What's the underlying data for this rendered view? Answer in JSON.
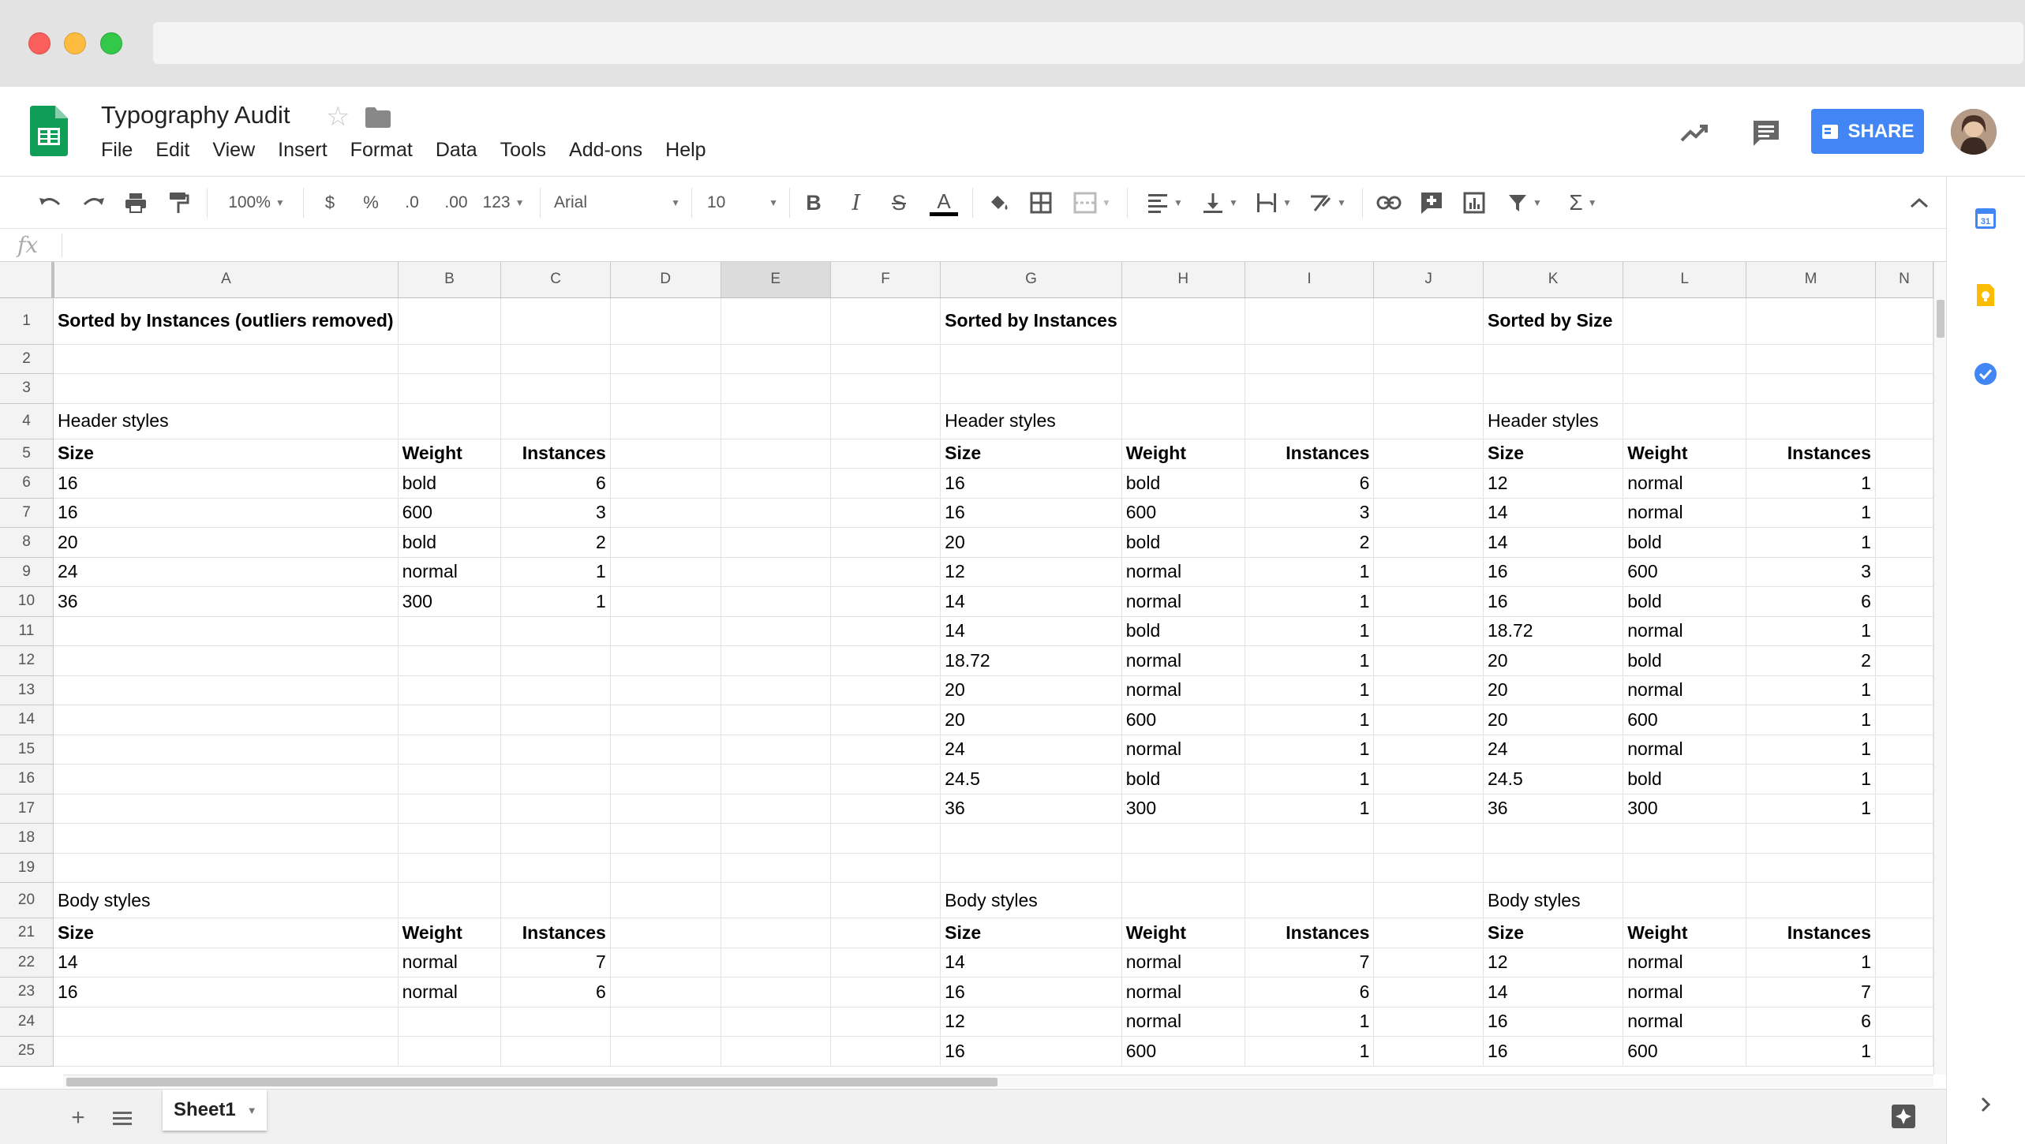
{
  "doc": {
    "title": "Typography Audit"
  },
  "menu": [
    "File",
    "Edit",
    "View",
    "Insert",
    "Format",
    "Data",
    "Tools",
    "Add-ons",
    "Help"
  ],
  "share": {
    "label": "SHARE"
  },
  "toolbar": {
    "zoom": "100%",
    "currency": "$",
    "percent": "%",
    "dec_less": ".0",
    "dec_more": ".00",
    "more_formats": "123",
    "font": "Arial",
    "font_size": "10"
  },
  "formula_bar": {
    "fx": "fx",
    "value": ""
  },
  "columns": [
    "A",
    "B",
    "C",
    "D",
    "E",
    "F",
    "G",
    "H",
    "I",
    "J",
    "K",
    "L",
    "M",
    "N"
  ],
  "selected_column": "E",
  "sections": {
    "left_title": "Sorted by Instances (outliers removed)",
    "mid_title": "Sorted by Instances",
    "right_title": "Sorted by Size",
    "header_styles": "Header styles",
    "body_styles": "Body styles",
    "col_size": "Size",
    "col_weight": "Weight",
    "col_instances": "Instances"
  },
  "left_header": [
    [
      "16",
      "bold",
      "6"
    ],
    [
      "16",
      "600",
      "3"
    ],
    [
      "20",
      "bold",
      "2"
    ],
    [
      "24",
      "normal",
      "1"
    ],
    [
      "36",
      "300",
      "1"
    ]
  ],
  "mid_header": [
    [
      "16",
      "bold",
      "6"
    ],
    [
      "16",
      "600",
      "3"
    ],
    [
      "20",
      "bold",
      "2"
    ],
    [
      "12",
      "normal",
      "1"
    ],
    [
      "14",
      "normal",
      "1"
    ],
    [
      "14",
      "bold",
      "1"
    ],
    [
      "18.72",
      "normal",
      "1"
    ],
    [
      "20",
      "normal",
      "1"
    ],
    [
      "20",
      "600",
      "1"
    ],
    [
      "24",
      "normal",
      "1"
    ],
    [
      "24.5",
      "bold",
      "1"
    ],
    [
      "36",
      "300",
      "1"
    ]
  ],
  "right_header": [
    [
      "12",
      "normal",
      "1"
    ],
    [
      "14",
      "normal",
      "1"
    ],
    [
      "14",
      "bold",
      "1"
    ],
    [
      "16",
      "600",
      "3"
    ],
    [
      "16",
      "bold",
      "6"
    ],
    [
      "18.72",
      "normal",
      "1"
    ],
    [
      "20",
      "bold",
      "2"
    ],
    [
      "20",
      "normal",
      "1"
    ],
    [
      "20",
      "600",
      "1"
    ],
    [
      "24",
      "normal",
      "1"
    ],
    [
      "24.5",
      "bold",
      "1"
    ],
    [
      "36",
      "300",
      "1"
    ]
  ],
  "left_body": [
    [
      "14",
      "normal",
      "7"
    ],
    [
      "16",
      "normal",
      "6"
    ]
  ],
  "mid_body": [
    [
      "14",
      "normal",
      "7"
    ],
    [
      "16",
      "normal",
      "6"
    ],
    [
      "12",
      "normal",
      "1"
    ],
    [
      "16",
      "600",
      "1"
    ]
  ],
  "right_body": [
    [
      "12",
      "normal",
      "1"
    ],
    [
      "14",
      "normal",
      "7"
    ],
    [
      "16",
      "normal",
      "6"
    ],
    [
      "16",
      "600",
      "1"
    ]
  ],
  "sheets": [
    {
      "name": "Sheet1"
    }
  ]
}
